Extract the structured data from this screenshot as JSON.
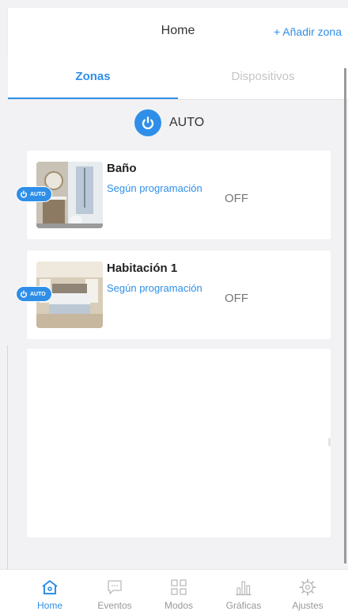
{
  "header": {
    "title": "Home",
    "add_zone": "+ Añadir zona"
  },
  "tabs": [
    {
      "label": "Zonas",
      "active": true
    },
    {
      "label": "Dispositivos",
      "active": false
    }
  ],
  "mode": {
    "label": "AUTO",
    "icon": "power-icon"
  },
  "zones": [
    {
      "name": "Baño",
      "schedule": "Según programación",
      "state": "OFF",
      "badge": "AUTO"
    },
    {
      "name": "Habitación 1",
      "schedule": "Según programación",
      "state": "OFF",
      "badge": "AUTO"
    }
  ],
  "nav": [
    {
      "label": "Home",
      "icon": "home-icon",
      "active": true
    },
    {
      "label": "Eventos",
      "icon": "chat-icon",
      "active": false
    },
    {
      "label": "Modos",
      "icon": "grid-icon",
      "active": false
    },
    {
      "label": "Gráficas",
      "icon": "bar-chart-icon",
      "active": false
    },
    {
      "label": "Ajustes",
      "icon": "gear-icon",
      "active": false
    }
  ],
  "colors": {
    "accent": "#2f8fe8",
    "inactive": "#999999",
    "background": "#f2f2f4"
  }
}
